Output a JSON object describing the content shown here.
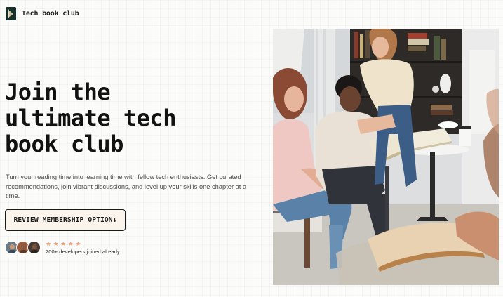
{
  "brand": {
    "name": "Tech book club"
  },
  "hero": {
    "title_lines": [
      "Join the",
      "ultimate tech",
      "book club"
    ],
    "subtitle": "Turn your reading time into learning time with fellow tech enthusiasts. Get curated recommendations, join vibrant discussions, and level up your skills one chapter at a time.",
    "cta_label": "REVIEW MEMBERSHIP OPTION↓"
  },
  "social_proof": {
    "rating": 5,
    "rating_max": 5,
    "star_color": "#f0a07a",
    "label": "200+ developers joined already",
    "avatars": [
      "avatar-1",
      "avatar-2",
      "avatar-3"
    ]
  },
  "photo": {
    "icon": "people-reading-books-photo"
  },
  "colors": {
    "accent": "#f0a07a",
    "cta_bg": "#fbf4ec",
    "logo_bg": "#17302c"
  }
}
